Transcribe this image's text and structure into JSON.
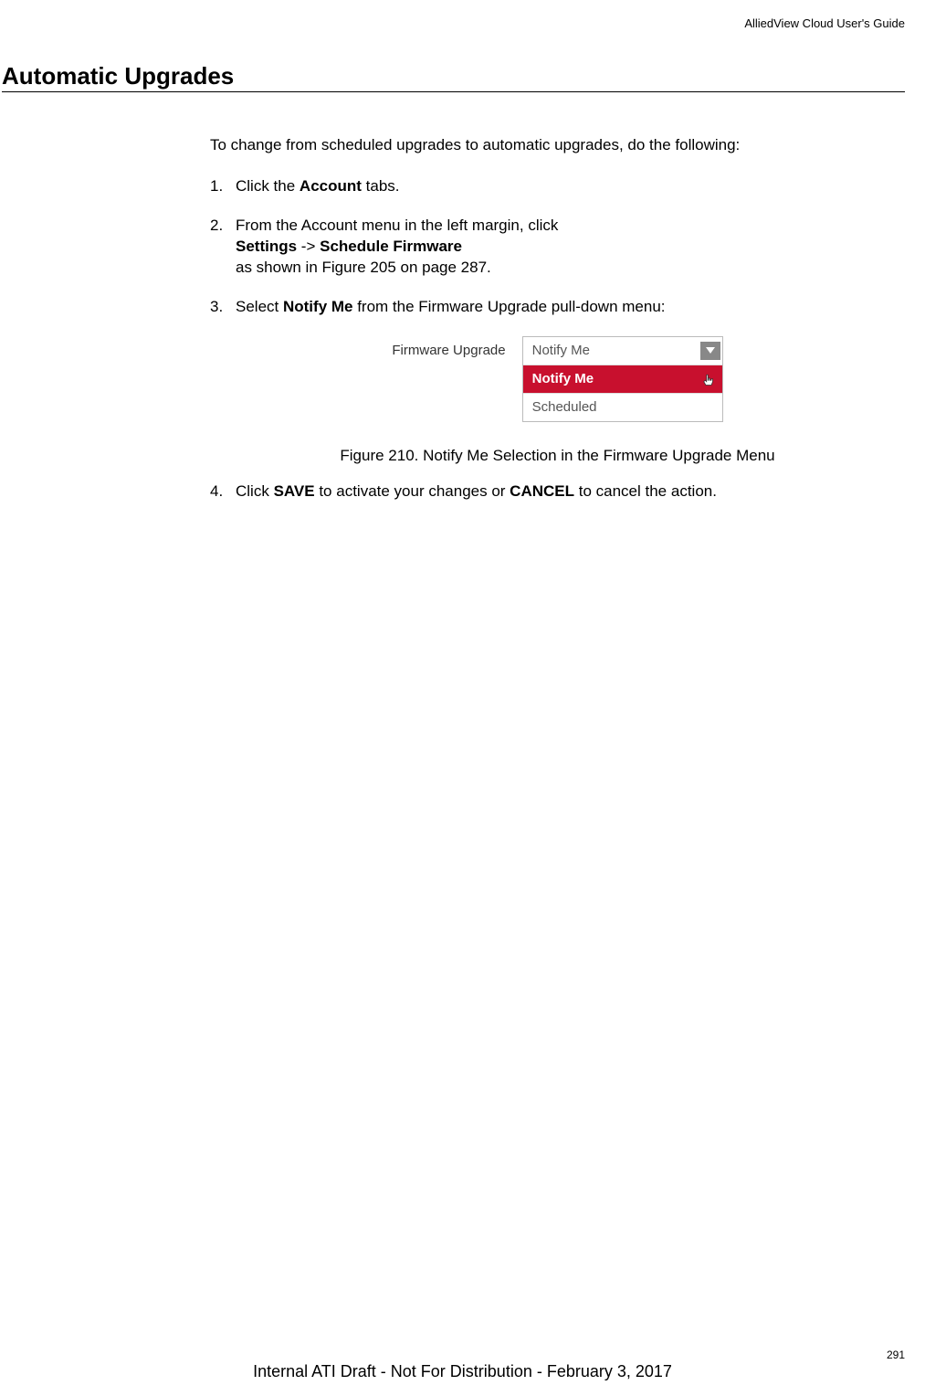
{
  "header": {
    "guide_title": "AlliedView Cloud User's Guide"
  },
  "section": {
    "title": "Automatic Upgrades"
  },
  "content": {
    "intro": "To change from scheduled upgrades to automatic upgrades, do the following:",
    "steps": [
      {
        "num": "1.",
        "text_before": "Click the ",
        "bold1": "Account",
        "text_after": " tabs."
      },
      {
        "num": "2.",
        "line1": "From the Account menu in the left margin, click",
        "bold1": "Settings",
        "arrow": " -> ",
        "bold2": "Schedule Firmware",
        "line3": "as shown in Figure 205 on page 287."
      },
      {
        "num": "3.",
        "text_before": "Select ",
        "bold1": "Notify Me",
        "text_after": " from the Firmware Upgrade pull-down menu:"
      },
      {
        "num": "4.",
        "text_before": "Click ",
        "bold1": "SAVE",
        "text_mid": " to activate your changes or ",
        "bold2": "CANCEL",
        "text_after": " to cancel the action."
      }
    ]
  },
  "figure": {
    "label": "Firmware Upgrade",
    "options": {
      "top": "Notify Me",
      "highlighted": "Notify Me",
      "bottom": "Scheduled"
    },
    "caption": "Figure 210. Notify Me Selection in the Firmware Upgrade Menu"
  },
  "footer": {
    "page_number": "291",
    "draft_text": "Internal ATI Draft - Not For Distribution - February 3, 2017"
  }
}
